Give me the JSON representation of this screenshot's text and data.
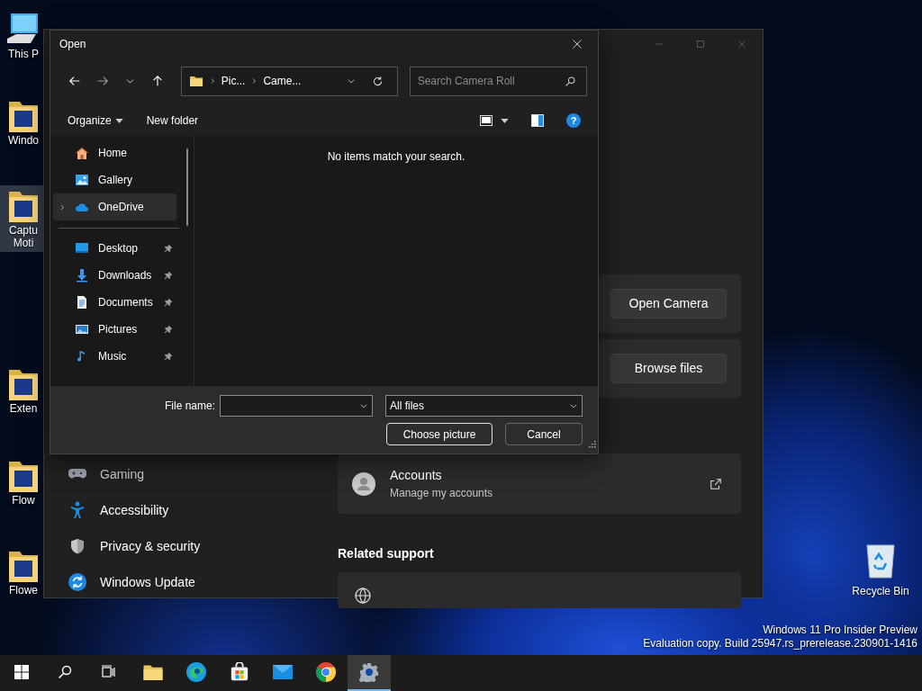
{
  "desktop_icons": [
    {
      "lines": [
        "This P"
      ],
      "selected": false
    },
    {
      "lines": [
        "Windo"
      ],
      "selected": false
    },
    {
      "lines": [
        "Captu",
        "Moti"
      ],
      "selected": true
    },
    {
      "lines": [
        "Exten"
      ],
      "selected": false
    },
    {
      "lines": [
        "Flow"
      ],
      "selected": false
    },
    {
      "lines": [
        "Flowe"
      ],
      "selected": false
    }
  ],
  "recycle_bin": {
    "label": "Recycle Bin"
  },
  "settings_window": {
    "nav": [
      {
        "label": "Gaming"
      },
      {
        "label": "Accessibility"
      },
      {
        "label": "Privacy & security"
      },
      {
        "label": "Windows Update"
      }
    ],
    "camera_button": "Open Camera",
    "browse_button": "Browse files",
    "accounts": {
      "title": "Accounts",
      "subtitle": "Manage my accounts"
    },
    "related_support": "Related support"
  },
  "open_dialog": {
    "title": "Open",
    "breadcrumb": [
      "Pic...",
      "Came..."
    ],
    "search_placeholder": "Search Camera Roll",
    "toolbar": {
      "organize": "Organize",
      "new_folder": "New folder",
      "help": "?"
    },
    "quick_items": [
      {
        "label": "Home",
        "selected": false,
        "expandable": false,
        "pinned": false
      },
      {
        "label": "Gallery",
        "selected": false,
        "expandable": false,
        "pinned": false
      },
      {
        "label": "OneDrive",
        "selected": true,
        "expandable": true,
        "pinned": false
      }
    ],
    "pinned_items": [
      {
        "label": "Desktop",
        "selected": false,
        "expandable": false,
        "pinned": true
      },
      {
        "label": "Downloads",
        "selected": false,
        "expandable": false,
        "pinned": true
      },
      {
        "label": "Documents",
        "selected": false,
        "expandable": false,
        "pinned": true
      },
      {
        "label": "Pictures",
        "selected": false,
        "expandable": false,
        "pinned": true
      },
      {
        "label": "Music",
        "selected": false,
        "expandable": false,
        "pinned": true
      }
    ],
    "empty_message": "No items match your search.",
    "file_name_label": "File name:",
    "file_type": "All files",
    "buttons": [
      {
        "label": "Choose picture",
        "default": true
      },
      {
        "label": "Cancel",
        "default": false
      }
    ]
  },
  "build_info": [
    "Windows 11 Pro Insider Preview",
    "Evaluation copy. Build 25947.rs_prerelease.230901-1416"
  ],
  "taskbar": {
    "apps": [
      {
        "active": false
      },
      {
        "active": false
      },
      {
        "active": false
      },
      {
        "active": false
      },
      {
        "active": false
      },
      {
        "active": false
      },
      {
        "active": false
      },
      {
        "active": false
      },
      {
        "active": true
      }
    ]
  }
}
